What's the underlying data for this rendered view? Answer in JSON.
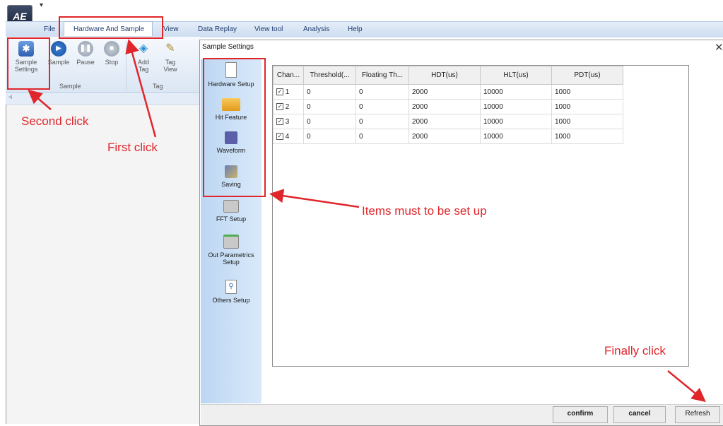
{
  "app": {
    "quick_access": "▾",
    "menu": [
      "File",
      "Hardware And Sample",
      "View",
      "Data Replay",
      "View tool",
      "Analysis",
      "Help"
    ]
  },
  "ribbon": {
    "buttons": [
      {
        "label": "Sample\nSettings",
        "icon": "sample-settings-icon"
      },
      {
        "label": "Sample",
        "icon": "play-icon"
      },
      {
        "label": "Pause",
        "icon": "pause-icon"
      },
      {
        "label": "Stop",
        "icon": "stop-icon"
      },
      {
        "label": "Add\nTag",
        "icon": "add-tag-icon"
      },
      {
        "label": "Tag\nView",
        "icon": "tag-view-icon"
      }
    ],
    "groups": [
      "Sample",
      "Tag"
    ],
    "strip_arrow": "◃"
  },
  "dialog": {
    "title": "Sample Settings",
    "close": "✕",
    "side_items": [
      {
        "label": "Hardware Setup",
        "icon": "document-icon"
      },
      {
        "label": "Hit Feature",
        "icon": "folder-icon"
      },
      {
        "label": "Waveform",
        "icon": "floppy-icon"
      },
      {
        "label": "Saving",
        "icon": "saving-icon"
      },
      {
        "label": "FFT Setup",
        "icon": "printer-icon"
      },
      {
        "label": "Out Parametrics\nSetup",
        "icon": "printer-check-icon"
      },
      {
        "label": "Others Setup",
        "icon": "magnifier-document-icon"
      }
    ],
    "table": {
      "columns": [
        "Chan...",
        "Threshold(...",
        "Floating Th...",
        "HDT(us)",
        "HLT(us)",
        "PDT(us)"
      ],
      "rows": [
        {
          "channel": "1",
          "checked": true,
          "threshold": "0",
          "floating": "0",
          "hdt": "2000",
          "hlt": "10000",
          "pdt": "1000"
        },
        {
          "channel": "2",
          "checked": true,
          "threshold": "0",
          "floating": "0",
          "hdt": "2000",
          "hlt": "10000",
          "pdt": "1000"
        },
        {
          "channel": "3",
          "checked": true,
          "threshold": "0",
          "floating": "0",
          "hdt": "2000",
          "hlt": "10000",
          "pdt": "1000"
        },
        {
          "channel": "4",
          "checked": true,
          "threshold": "0",
          "floating": "0",
          "hdt": "2000",
          "hlt": "10000",
          "pdt": "1000"
        }
      ]
    },
    "buttons": {
      "confirm": "confirm",
      "cancel": "cancel",
      "refresh": "Refresh"
    }
  },
  "annotations": {
    "second_click": "Second click",
    "first_click": "First click",
    "items_setup": "Items must to be set up",
    "finally_click": "Finally click",
    "color": "#e0262a"
  }
}
